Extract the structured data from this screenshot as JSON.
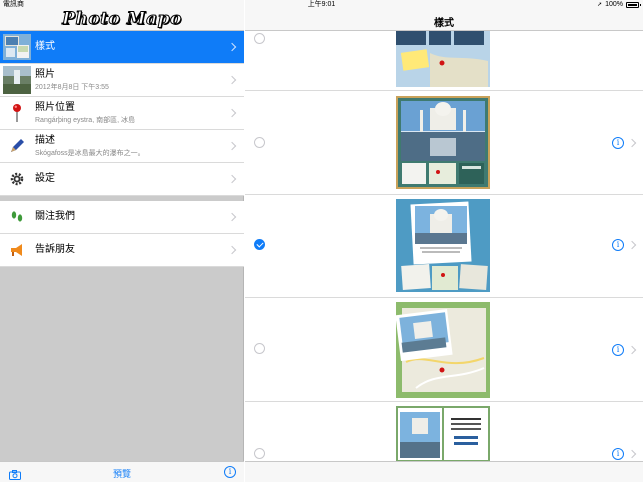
{
  "status": {
    "carrier": "電訊商",
    "time": "上午9:01",
    "battery": "100%"
  },
  "sidebar": {
    "logo_text": "Photo Mapo",
    "items": [
      {
        "title": "樣式",
        "subtitle": "",
        "icon": "style-thumbnail",
        "selected": true
      },
      {
        "title": "照片",
        "subtitle": "2012年8月8日 下午3:55",
        "icon": "photo-thumbnail",
        "selected": false
      },
      {
        "title": "照片位置",
        "subtitle": "Rangárþing eystra, 南部區, 冰島",
        "icon": "pin-icon",
        "selected": false
      },
      {
        "title": "描述",
        "subtitle": "Skógafoss是冰島最大的瀑布之一。",
        "icon": "pen-icon",
        "selected": false
      },
      {
        "title": "設定",
        "subtitle": "",
        "icon": "gear-icon",
        "selected": false
      }
    ],
    "items2": [
      {
        "title": "關注我們",
        "icon": "footprints-icon"
      },
      {
        "title": "告訴朋友",
        "icon": "megaphone-icon"
      }
    ],
    "toolbar": {
      "preview_label": "預覽",
      "info_glyph": "i"
    }
  },
  "main": {
    "title": "樣式",
    "info_glyph": "i",
    "styles": [
      {
        "name": "style-1",
        "selected": false,
        "has_info": false
      },
      {
        "name": "style-2",
        "selected": false,
        "has_info": true
      },
      {
        "name": "style-3",
        "selected": true,
        "has_info": true
      },
      {
        "name": "style-4",
        "selected": false,
        "has_info": true
      },
      {
        "name": "style-5",
        "selected": false,
        "has_info": true
      }
    ]
  },
  "colors": {
    "accent": "#0f7cf8",
    "sidebar_bg": "#cbcbcb"
  }
}
